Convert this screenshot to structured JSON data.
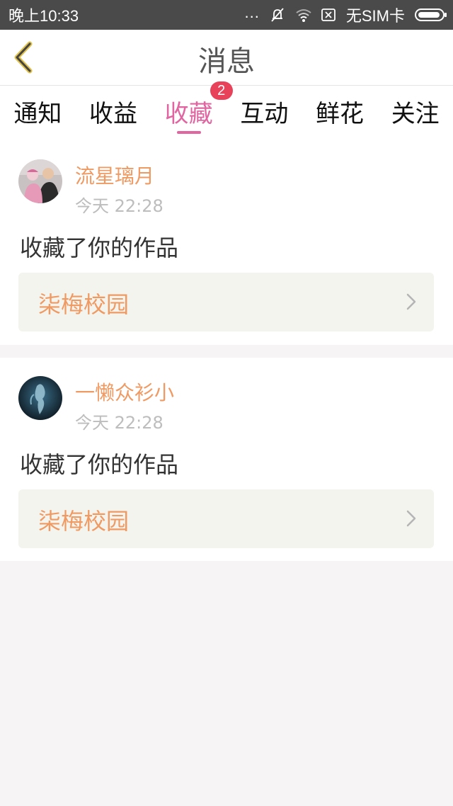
{
  "status_bar": {
    "time": "晚上10:33",
    "dots": "...",
    "carrier": "无SIM卡",
    "icons": [
      "silent-bell-icon",
      "wifi-icon",
      "sim-off-icon",
      "battery-icon"
    ]
  },
  "header": {
    "title": "消息",
    "back_icon": "back-chevron-icon"
  },
  "tabs": [
    {
      "label": "通知"
    },
    {
      "label": "收益"
    },
    {
      "label": "收藏",
      "active": true,
      "badge": "2"
    },
    {
      "label": "互动"
    },
    {
      "label": "鲜花"
    },
    {
      "label": "关注"
    }
  ],
  "messages": [
    {
      "user": "流星璃月",
      "time": "今天 22:28",
      "action": "收藏了你的作品",
      "work": "柒梅校园"
    },
    {
      "user": "一懒众衫小",
      "time": "今天 22:28",
      "action": "收藏了你的作品",
      "work": "柒梅校园"
    }
  ],
  "colors": {
    "accent_pink": "#e065a0",
    "badge_red": "#e8425a",
    "username_orange": "#f09a63",
    "status_bar": "#4a4a4a"
  }
}
